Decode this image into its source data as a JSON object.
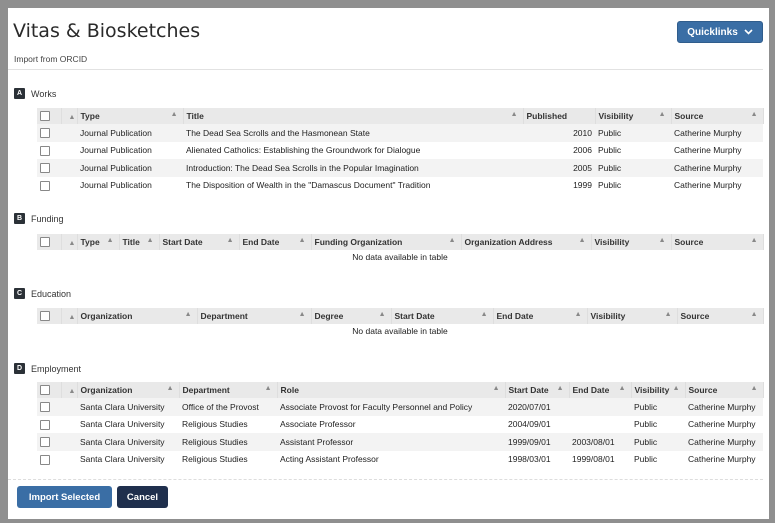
{
  "page": {
    "title": "Vitas & Biosketches",
    "subtitle": "Import from ORCID"
  },
  "quicklinks": {
    "label": "Quicklinks"
  },
  "sections": {
    "works": {
      "letter": "A",
      "label": "Works",
      "columns": [
        "Type",
        "Title",
        "Published",
        "Visibility",
        "Source"
      ],
      "rows": [
        [
          "Journal Publication",
          "The Dead Sea Scrolls and the Hasmonean State",
          "2010",
          "Public",
          "Catherine Murphy"
        ],
        [
          "Journal Publication",
          "Alienated Catholics: Establishing the Groundwork for Dialogue",
          "2006",
          "Public",
          "Catherine Murphy"
        ],
        [
          "Journal Publication",
          "Introduction: The Dead Sea Scrolls in the Popular Imagination",
          "2005",
          "Public",
          "Catherine Murphy"
        ],
        [
          "Journal Publication",
          "The Disposition of Wealth in the \"Damascus Document\" Tradition",
          "1999",
          "Public",
          "Catherine Murphy"
        ]
      ]
    },
    "funding": {
      "letter": "B",
      "label": "Funding",
      "columns": [
        "Type",
        "Title",
        "Start Date",
        "End Date",
        "Funding Organization",
        "Organization Address",
        "Visibility",
        "Source"
      ],
      "empty": "No data available in table"
    },
    "education": {
      "letter": "C",
      "label": "Education",
      "columns": [
        "Organization",
        "Department",
        "Degree",
        "Start Date",
        "End Date",
        "Visibility",
        "Source"
      ],
      "empty": "No data available in table"
    },
    "employment": {
      "letter": "D",
      "label": "Employment",
      "columns": [
        "Organization",
        "Department",
        "Role",
        "Start Date",
        "End Date",
        "Visibility",
        "Source"
      ],
      "rows": [
        [
          "Santa Clara University",
          "Office of the Provost",
          "Associate Provost for Faculty Personnel and Policy",
          "2020/07/01",
          "",
          "Public",
          "Catherine Murphy"
        ],
        [
          "Santa Clara University",
          "Religious Studies",
          "Associate Professor",
          "2004/09/01",
          "",
          "Public",
          "Catherine Murphy"
        ],
        [
          "Santa Clara University",
          "Religious Studies",
          "Assistant Professor",
          "1999/09/01",
          "2003/08/01",
          "Public",
          "Catherine Murphy"
        ],
        [
          "Santa Clara University",
          "Religious Studies",
          "Acting Assistant Professor",
          "1998/03/01",
          "1999/08/01",
          "Public",
          "Catherine Murphy"
        ]
      ]
    }
  },
  "buttons": {
    "import": "Import Selected",
    "cancel": "Cancel"
  },
  "icons": {
    "checkbox": "checkbox-icon",
    "sort": "sort-caret-icon",
    "chevron": "chevron-down-icon"
  },
  "colors": {
    "primary": "#3a6ea5",
    "cancel": "#1f2f4d",
    "section_badge": "#2b3137"
  }
}
